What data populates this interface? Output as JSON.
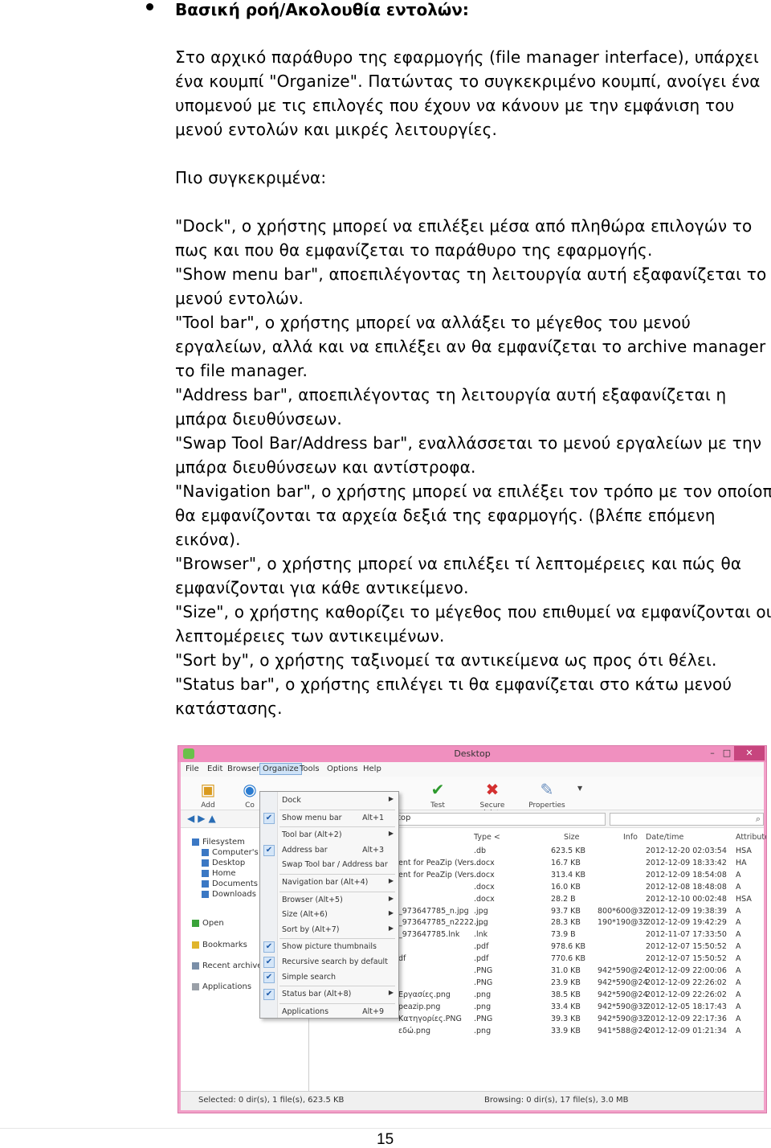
{
  "heading": "Βασική ροή/Ακολουθία εντολών:",
  "intro_lines": [
    "Στο αρχικό παράθυρο της εφαρμογής (file manager interface), υπάρχει",
    "ένα κουμπί \"Organize\". Πατώντας το συγκεκριμένο κουμπί, ανοίγει ένα",
    "υπομενού με τις επιλογές που έχουν να κάνουν με την εμφάνιση του",
    "μενού εντολών και μικρές λειτουργίες."
  ],
  "specifically": "Πιο συγκεκριμένα:",
  "items_lines": [
    "\"Dock\", ο χρήστης μπορεί να επιλέξει μέσα από πληθώρα επιλογών το",
    "πως και που θα εμφανίζεται το παράθυρο της εφαρμογής.",
    "\"Show menu bar\", αποεπιλέγοντας τη λειτουργία αυτή εξαφανίζεται το",
    "μενού εντολών.",
    "\"Tool bar\", ο χρήστης μπορεί να αλλάξει το μέγεθος του μενού",
    "εργαλείων, αλλά και να επιλέξει αν θα εμφανίζεται το archive manager ή",
    "το file manager.",
    "\"Address bar\", αποεπιλέγοντας τη λειτουργία αυτή εξαφανίζεται η",
    "μπάρα διευθύνσεων.",
    "\"Swap Tool Bar/Address bar\", εναλλάσσεται το μενού εργαλείων με την",
    "μπάρα διευθύνσεων και αντίστροφα.",
    "\"Navigation bar\", ο χρήστης μπορεί να επιλέξει τον τρόπο με τον οποίοπ",
    "θα εμφανίζονται τα αρχεία δεξιά της εφαρμογής. (βλέπε επόμενη",
    "εικόνα).",
    "\"Browser\", ο χρήστης μπορεί να επιλέξει τί λεπτομέρειες και πώς θα",
    "εμφανίζονται για κάθε αντικείμενο.",
    "\"Size\", ο χρήστης καθορίζει το μέγεθος που επιθυμεί να εμφανίζονται οι",
    "λεπτομέρειες των αντικειμένων.",
    "\"Sort by\", ο χρήστης ταξινομεί τα αντικείμενα ως προς ότι θέλει.",
    "\"Status bar\", ο χρήστης επιλέγει τι θα εμφανίζεται στο κάτω μενού",
    "κατάστασης."
  ],
  "screenshot": {
    "title": "Desktop",
    "window_buttons": [
      "–",
      "□",
      "✕"
    ],
    "menubar": [
      "File",
      "Edit",
      "Browser",
      "Organize",
      "Tools",
      "Options",
      "Help"
    ],
    "toolbar": [
      {
        "label": "Add",
        "icon": "add-icon"
      },
      {
        "label": "Co",
        "icon": "convert-icon"
      },
      {
        "label": "Test",
        "icon": "check-icon"
      },
      {
        "label": "Secure delete",
        "icon": "delete-icon"
      },
      {
        "label": "Properties",
        "icon": "properties-icon"
      }
    ],
    "address_value": "top",
    "sidebar": [
      "Filesystem",
      "Computer's r",
      "Desktop",
      "Home",
      "Documents",
      "Downloads",
      "Open",
      "Bookmarks",
      "Recent archives",
      "Applications"
    ],
    "file_columns": [
      "Type <",
      "Size",
      "Info",
      "Date/time",
      "Attribute"
    ],
    "files": [
      {
        "name": "",
        "type": ".db",
        "size": "623.5 KB",
        "info": "",
        "date": "2012-12-20 02:03:54",
        "attr": "HSA"
      },
      {
        "name": "ent for PeaZip (Vers...",
        "type": ".docx",
        "size": "16.7 KB",
        "info": "",
        "date": "2012-12-09 18:33:42",
        "attr": "HA"
      },
      {
        "name": "ent for PeaZip (Vers...",
        "type": ".docx",
        "size": "313.4 KB",
        "info": "",
        "date": "2012-12-09 18:54:08",
        "attr": "A"
      },
      {
        "name": "",
        "type": ".docx",
        "size": "16.0 KB",
        "info": "",
        "date": "2012-12-08 18:48:08",
        "attr": "A"
      },
      {
        "name": "",
        "type": ".docx",
        "size": "28.2 B",
        "info": "",
        "date": "2012-12-10 00:02:48",
        "attr": "HSA"
      },
      {
        "name": "_973647785_n.jpg",
        "type": ".jpg",
        "size": "93.7 KB",
        "info": "800*600@32",
        "date": "2012-12-09 19:38:39",
        "attr": "A"
      },
      {
        "name": "_973647785_n2222.j...",
        "type": ".jpg",
        "size": "28.3 KB",
        "info": "190*190@32",
        "date": "2012-12-09 19:42:29",
        "attr": "A"
      },
      {
        "name": "_973647785.lnk",
        "type": ".lnk",
        "size": "73.9 B",
        "info": "",
        "date": "2012-11-07 17:33:50",
        "attr": "A"
      },
      {
        "name": "",
        "type": ".pdf",
        "size": "978.6 KB",
        "info": "",
        "date": "2012-12-07 15:50:52",
        "attr": "A"
      },
      {
        "name": "df",
        "type": ".pdf",
        "size": "770.6 KB",
        "info": "",
        "date": "2012-12-07 15:50:52",
        "attr": "A"
      },
      {
        "name": "",
        "type": ".PNG",
        "size": "31.0 KB",
        "info": "942*590@24",
        "date": "2012-12-09 22:00:06",
        "attr": "A"
      },
      {
        "name": "",
        "type": ".PNG",
        "size": "23.9 KB",
        "info": "942*590@24",
        "date": "2012-12-09 22:26:02",
        "attr": "A"
      },
      {
        "name": "Εργασίες.png",
        "type": ".png",
        "size": "38.5 KB",
        "info": "942*590@24",
        "date": "2012-12-09 22:26:02",
        "attr": "A"
      },
      {
        "name": "peazip.png",
        "type": ".png",
        "size": "33.4 KB",
        "info": "942*590@32",
        "date": "2012-12-05 18:17:43",
        "attr": "A"
      },
      {
        "name": "Κατηγορίες.PNG",
        "type": ".PNG",
        "size": "39.3 KB",
        "info": "942*590@32",
        "date": "2012-12-09 22:17:36",
        "attr": "A"
      },
      {
        "name": "εδώ.png",
        "type": ".png",
        "size": "33.9 KB",
        "info": "941*588@24",
        "date": "2012-12-09 01:21:34",
        "attr": "A"
      }
    ],
    "status_left": "Selected: 0 dir(s), 1 file(s), 623.5 KB",
    "status_right": "Browsing: 0 dir(s), 17 file(s), 3.0 MB",
    "menu": [
      {
        "label": "Dock",
        "shortcut": "",
        "arrow": true,
        "check": false
      },
      {
        "label": "Show menu bar",
        "shortcut": "Alt+1",
        "arrow": false,
        "check": true
      },
      {
        "label": "Tool bar (Alt+2)",
        "shortcut": "",
        "arrow": true,
        "check": false
      },
      {
        "label": "Address bar",
        "shortcut": "Alt+3",
        "arrow": false,
        "check": true
      },
      {
        "label": "Swap Tool bar / Address bar",
        "shortcut": "",
        "arrow": false,
        "check": false
      },
      {
        "label": "Navigation bar (Alt+4)",
        "shortcut": "",
        "arrow": true,
        "check": false
      },
      {
        "label": "Browser (Alt+5)",
        "shortcut": "",
        "arrow": true,
        "check": false
      },
      {
        "label": "Size (Alt+6)",
        "shortcut": "",
        "arrow": true,
        "check": false
      },
      {
        "label": "Sort by (Alt+7)",
        "shortcut": "",
        "arrow": true,
        "check": false
      },
      {
        "label": "Show picture thumbnails",
        "shortcut": "",
        "arrow": false,
        "check": true
      },
      {
        "label": "Recursive search by default",
        "shortcut": "",
        "arrow": false,
        "check": true
      },
      {
        "label": "Simple search",
        "shortcut": "",
        "arrow": false,
        "check": true
      },
      {
        "label": "Status bar (Alt+8)",
        "shortcut": "",
        "arrow": true,
        "check": true
      },
      {
        "label": "Applications",
        "shortcut": "Alt+9",
        "arrow": false,
        "check": false
      }
    ]
  },
  "page_number": "15"
}
